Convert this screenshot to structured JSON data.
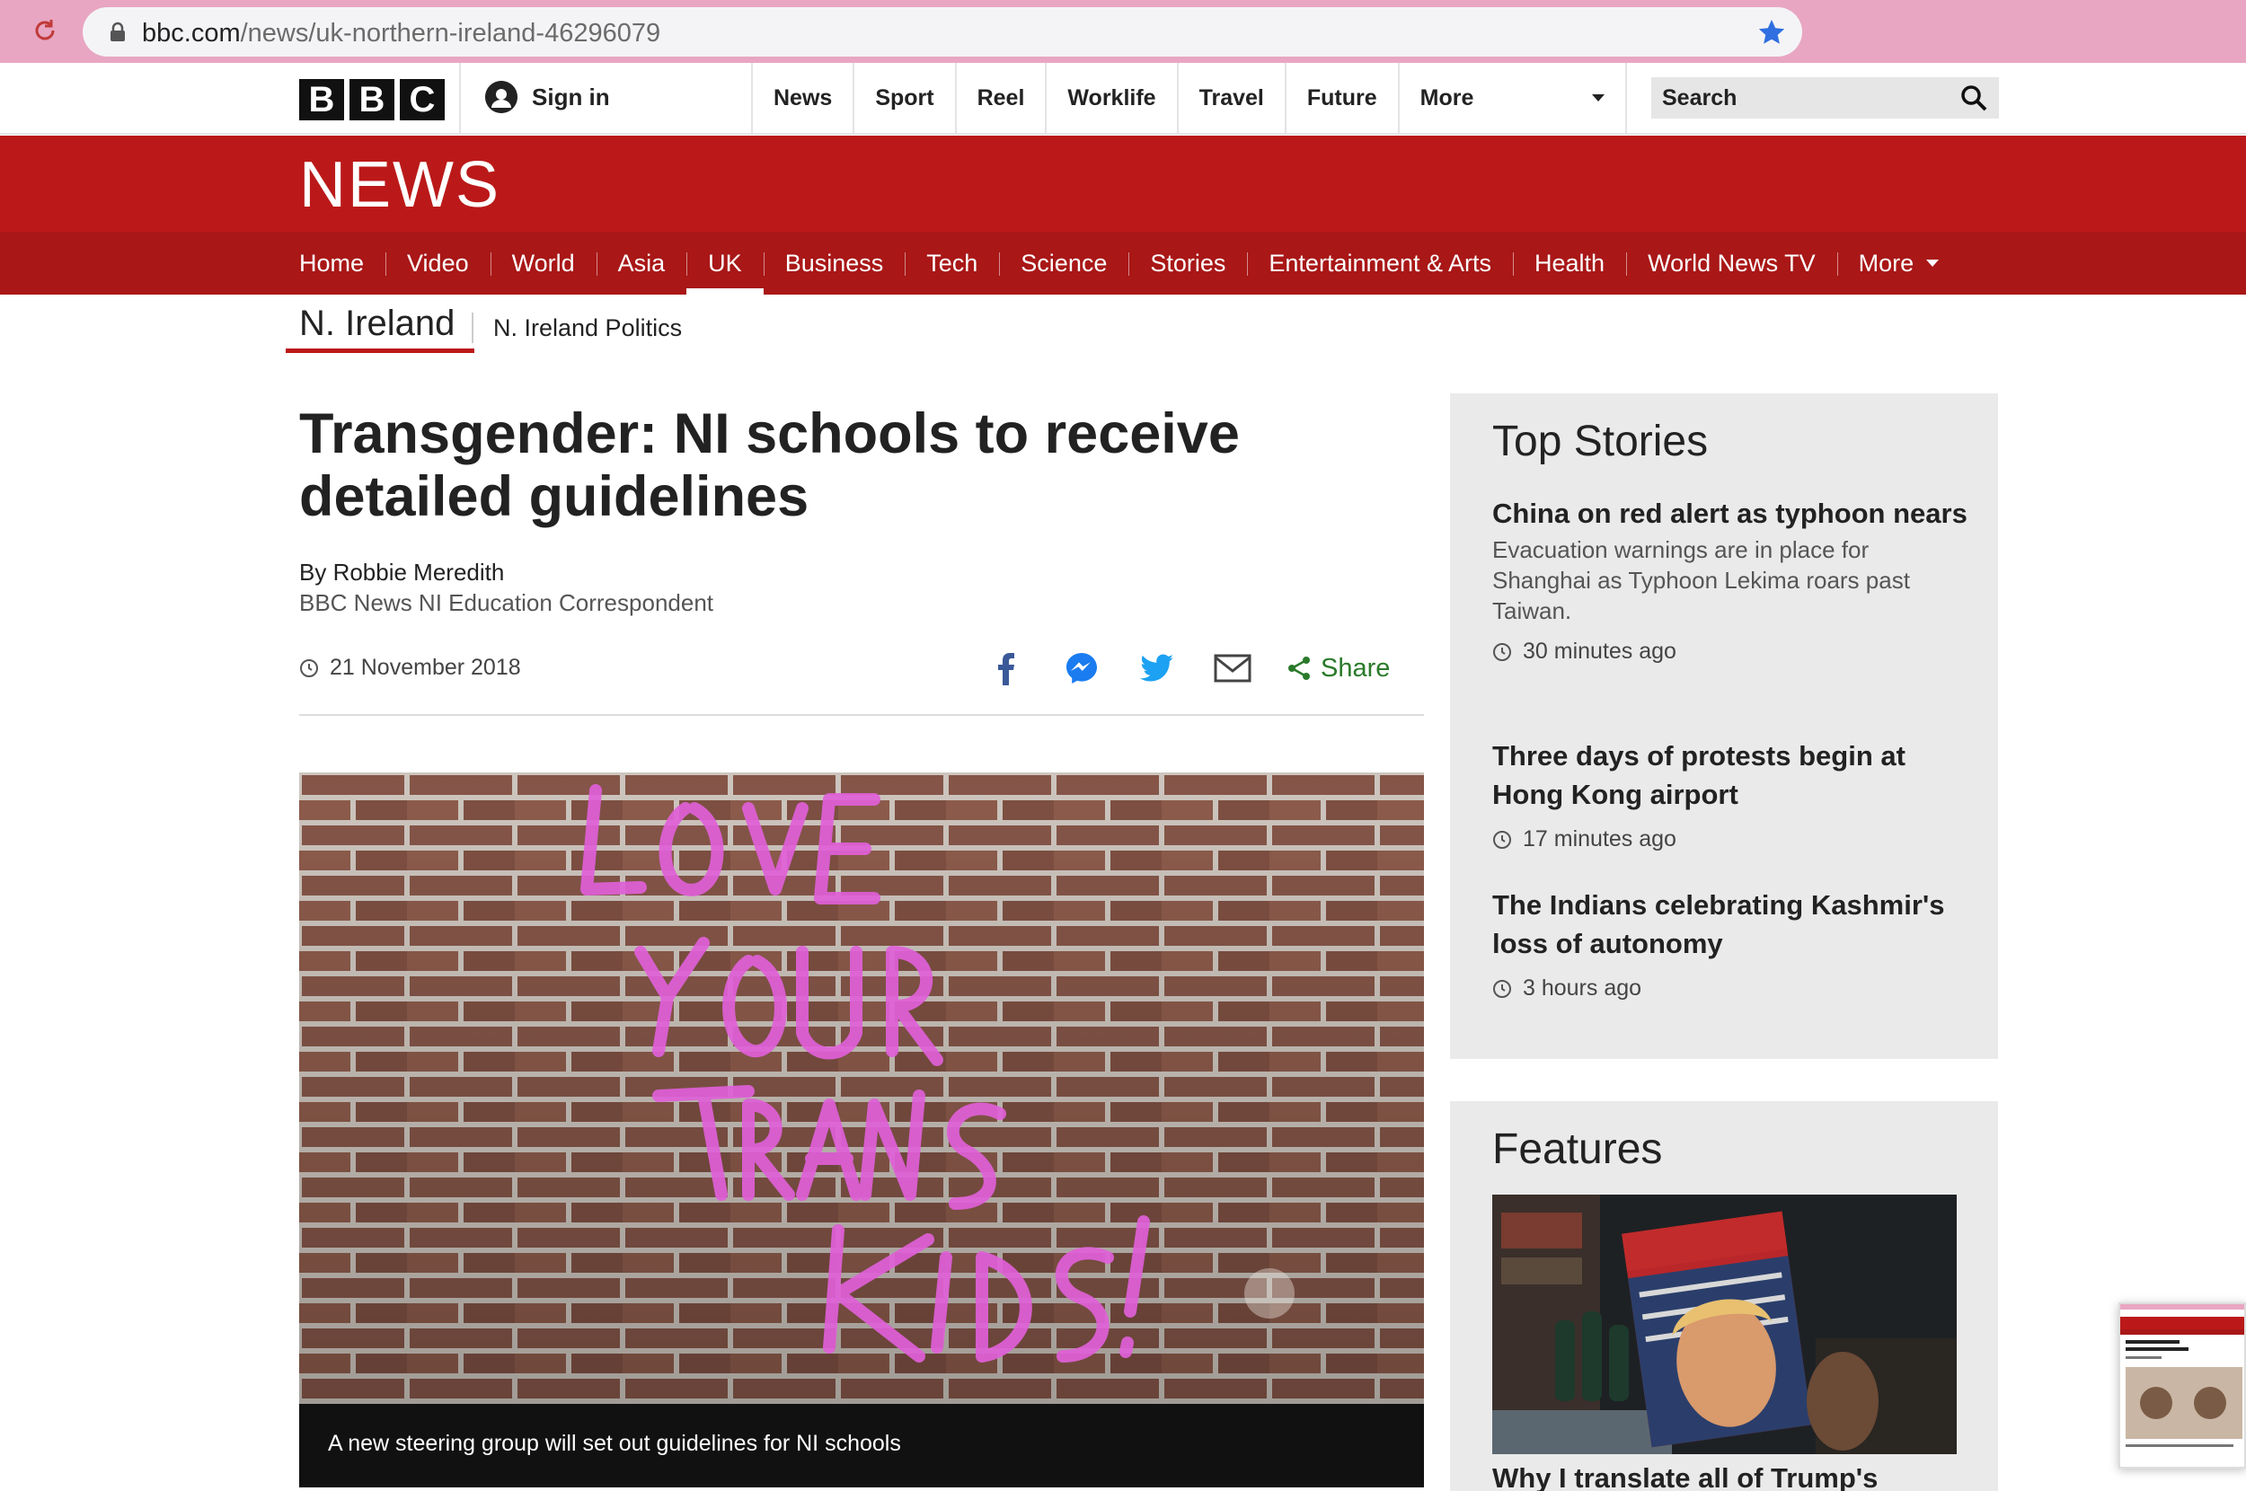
{
  "browser": {
    "url_domain": "bbc.com",
    "url_path": "/news/uk-northern-ireland-46296079"
  },
  "bbc_bar": {
    "logo_letters": [
      "B",
      "B",
      "C"
    ],
    "sign_in": "Sign in",
    "nav": [
      "News",
      "Sport",
      "Reel",
      "Worklife",
      "Travel",
      "Future"
    ],
    "more": "More",
    "search": "Search"
  },
  "news_band": {
    "title": "NEWS",
    "sections": [
      "Home",
      "Video",
      "World",
      "Asia",
      "UK",
      "Business",
      "Tech",
      "Science",
      "Stories",
      "Entertainment & Arts",
      "Health",
      "World News TV"
    ],
    "active_section": "UK",
    "more": "More"
  },
  "subnav": {
    "current": "N. Ireland",
    "link": "N. Ireland Politics"
  },
  "article": {
    "headline": "Transgender: NI schools to receive detailed guidelines",
    "author": "By Robbie Meredith",
    "role": "BBC News NI Education Correspondent",
    "date": "21 November 2018",
    "share_label": "Share",
    "share_icons": [
      "facebook-icon",
      "messenger-icon",
      "twitter-icon",
      "email-icon",
      "share-icon"
    ],
    "caption": "A new steering group will set out guidelines for NI schools"
  },
  "top_stories": {
    "heading": "Top Stories",
    "items": [
      {
        "title": "China on red alert as typhoon nears",
        "desc": "Evacuation warnings are in place for Shanghai as Typhoon Lekima roars past Taiwan.",
        "time": "30 minutes ago"
      },
      {
        "title": "Three days of protests begin at Hong Kong airport",
        "desc": "",
        "time": "17 minutes ago"
      },
      {
        "title": "The Indians celebrating Kashmir's loss of autonomy",
        "desc": "",
        "time": "3 hours ago"
      }
    ]
  },
  "features": {
    "heading": "Features",
    "first_title": "Why I translate all of Trump's"
  },
  "colors": {
    "bbc_red": "#bb1919",
    "section_red": "#a91717",
    "share_green": "#2a7a2a",
    "chrome_pink": "#e8a6c2"
  }
}
